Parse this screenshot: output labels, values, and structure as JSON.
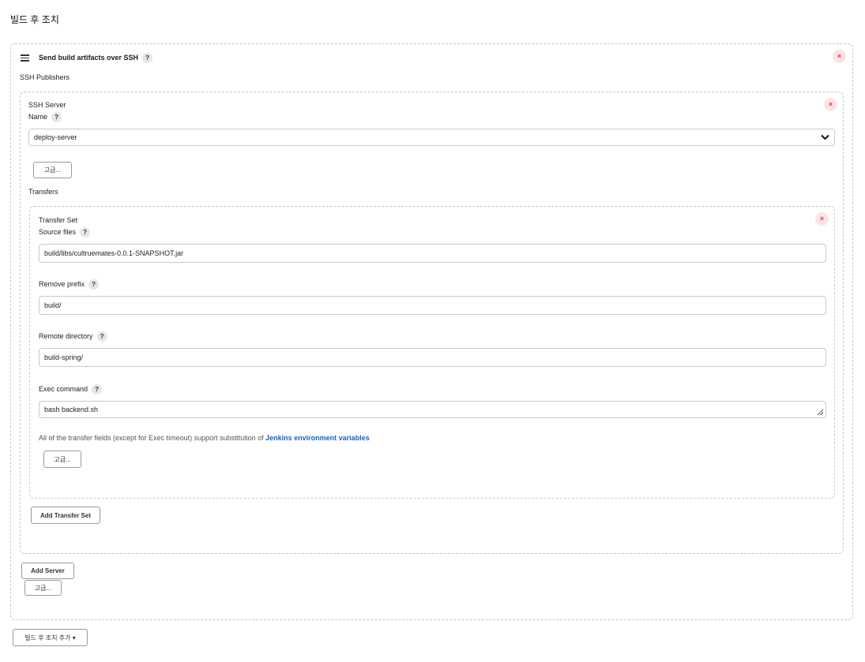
{
  "page": {
    "title": "빌드 후 조치"
  },
  "section": {
    "title": "Send build artifacts over SSH",
    "help": "?",
    "close": "×",
    "publishers_label": "SSH Publishers"
  },
  "server": {
    "header": "SSH Server",
    "name_label": "Name",
    "help": "?",
    "close": "×",
    "name_value": "deploy-server",
    "advanced_label": "고급...",
    "transfers_label": "Transfers"
  },
  "transfer": {
    "header": "Transfer Set",
    "close": "×",
    "help": "?",
    "source_label": "Source files",
    "source_value": "build/libs/cultruemates-0.0.1-SNAPSHOT.jar",
    "prefix_label": "Remove prefix",
    "prefix_value": "build/",
    "remote_label": "Remote directory",
    "remote_value": "build-spring/",
    "exec_label": "Exec command",
    "exec_value": "bash backend.sh",
    "note_text": "All of the transfer fields (except for Exec timeout) support substitution of ",
    "note_link": "Jenkins environment variables",
    "advanced_label": "고급..."
  },
  "buttons": {
    "add_transfer_set": "Add Transfer Set",
    "add_server": "Add Server",
    "advanced": "고급...",
    "add_post_build": "빌드 후 조치 추가 ▾"
  },
  "icons": {
    "drag": "drag-handle-icon",
    "close": "close-icon",
    "help": "help-icon",
    "dropdown": "chevron-down-icon",
    "resize": "resize-grip-icon"
  },
  "colors": {
    "border": "#c7c7cc",
    "close_bg": "#fbe3e6",
    "close_fg": "#e0364d",
    "link": "#1c61c1"
  }
}
